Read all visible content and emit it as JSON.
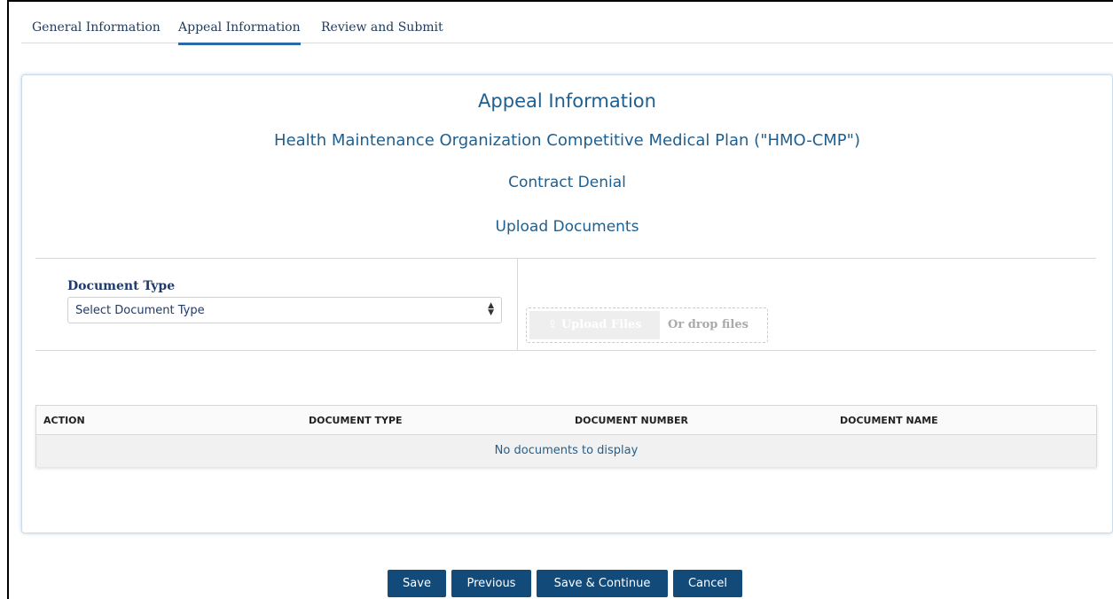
{
  "tabs": [
    {
      "label": "General Information"
    },
    {
      "label": "Appeal Information"
    },
    {
      "label": "Review and Submit"
    }
  ],
  "card": {
    "title": "Appeal Information",
    "plan": "Health Maintenance Organization Competitive Medical Plan (\"HMO-CMP\")",
    "action": "Contract Denial",
    "section": "Upload Documents"
  },
  "form": {
    "doc_type_label": "Document Type",
    "doc_type_selected": "Select Document Type",
    "upload_label": "Upload Files",
    "drop_label": "Or drop files"
  },
  "table": {
    "columns": [
      "ACTION",
      "DOCUMENT TYPE",
      "DOCUMENT NUMBER",
      "DOCUMENT NAME"
    ],
    "empty_message": "No documents to display"
  },
  "buttons": {
    "save": "Save",
    "previous": "Previous",
    "save_continue": "Save & Continue",
    "cancel": "Cancel"
  },
  "colors": {
    "accent": "#2b6aa8",
    "heading": "#1f5f8f",
    "button": "#124a7a"
  }
}
